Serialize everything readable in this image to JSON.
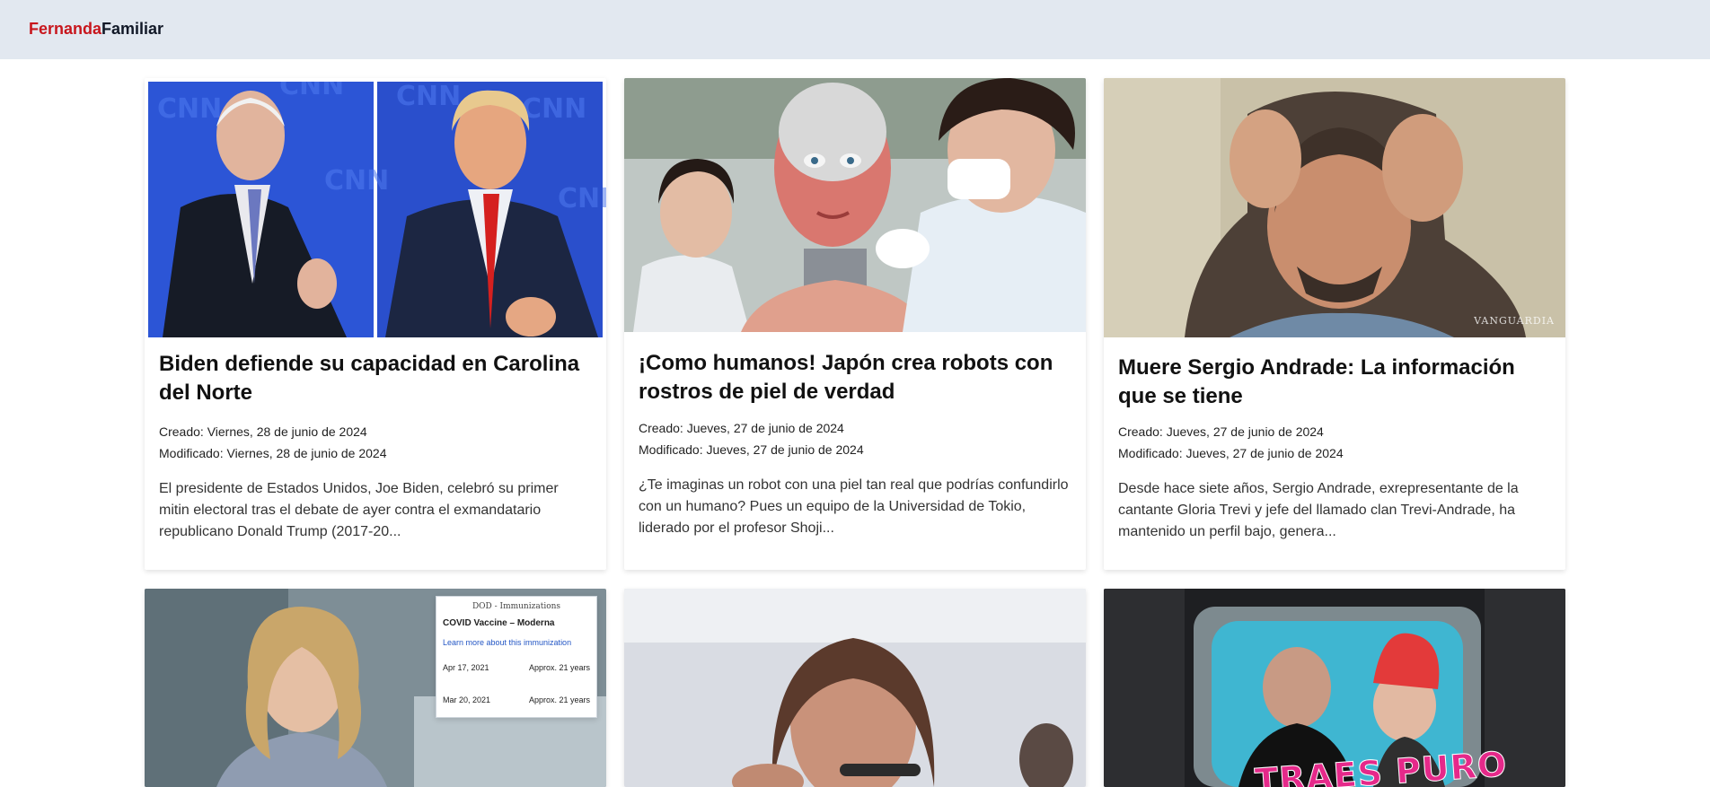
{
  "brand": {
    "part1": "Fernanda",
    "part2": "Familiar"
  },
  "labels": {
    "created": "Creado: ",
    "modified": "Modificado: "
  },
  "articles": [
    {
      "title": "Biden defiende su capacidad en Carolina del Norte",
      "created": "Viernes, 28 de junio de 2024",
      "modified": "Viernes, 28 de junio de 2024",
      "excerpt": "El presidente de Estados Unidos, Joe Biden, celebró su primer mitin electoral tras el debate de ayer contra el exmandatario republicano Donald Trump (2017-20..."
    },
    {
      "title": "¡Como humanos! Japón crea robots con rostros de piel de verdad",
      "created": "Jueves, 27 de junio de 2024",
      "modified": "Jueves, 27 de junio de 2024",
      "excerpt": "¿Te imaginas un robot con una piel tan real que podrías confundirlo con un humano? Pues un equipo de la Universidad de Tokio, liderado por el profesor Shoji..."
    },
    {
      "title": "Muere Sergio Andrade: La información que se tiene",
      "created": "Jueves, 27 de junio de 2024",
      "modified": "Jueves, 27 de junio de 2024",
      "excerpt": "Desde hace siete años, Sergio Andrade, exrepresentante de la cantante Gloria Trevi y jefe del llamado clan Trevi-Andrade, ha mantenido un perfil bajo, genera...",
      "watermark": "VANGUARDIA"
    }
  ],
  "second_row": {
    "vaccine": {
      "header": "DOD - Immunizations",
      "title": "COVID Vaccine – Moderna",
      "link": "Learn more about this immunization",
      "rows": [
        {
          "date": "Apr 17, 2021",
          "age": "Approx. 21 years"
        },
        {
          "date": "Mar 20, 2021",
          "age": "Approx. 21 years"
        }
      ]
    },
    "thumb3_text": "TRAES PURO"
  },
  "colors": {
    "brand_red": "#c8161d",
    "topbar": "#e2e8f0"
  }
}
